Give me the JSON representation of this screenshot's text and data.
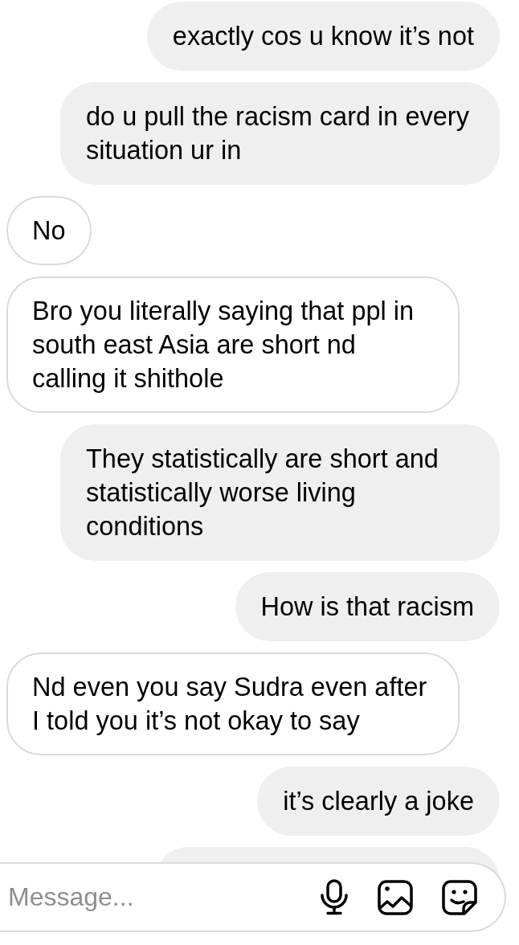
{
  "messages": [
    {
      "kind": "sent",
      "text": "exactly cos u know it’s not"
    },
    {
      "kind": "sent",
      "text": "do u pull the racism card in every situation ur in"
    },
    {
      "kind": "received",
      "text": "No"
    },
    {
      "kind": "received",
      "text": "Bro you literally saying that ppl in south east Asia are short nd calling it shithole"
    },
    {
      "kind": "sent",
      "text": "They statistically are short and statistically worse living conditions"
    },
    {
      "kind": "sent",
      "text": "How is that racism"
    },
    {
      "kind": "received",
      "text": "Nd even you say Sudra even after I told you it’s not okay to say"
    },
    {
      "kind": "sent",
      "text": "it’s clearly a joke"
    },
    {
      "kind": "sent"
    }
  ],
  "composer": {
    "placeholder": "Message..."
  }
}
